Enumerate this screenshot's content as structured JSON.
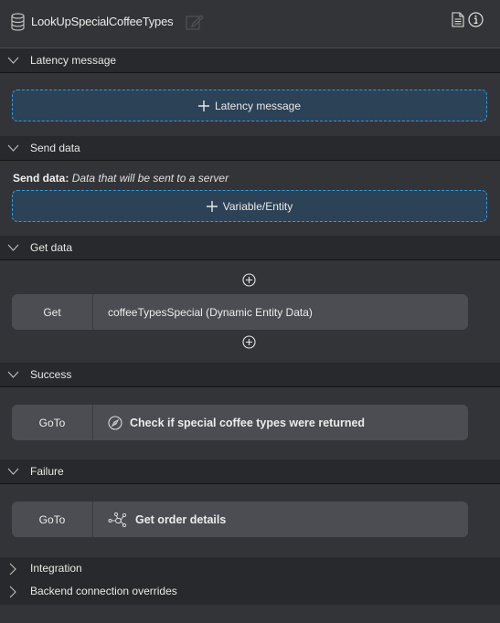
{
  "header": {
    "title": "LookUpSpecialCoffeeTypes",
    "icons": [
      "database-icon",
      "edit-icon",
      "document-icon",
      "info-icon"
    ]
  },
  "sections": {
    "latency": {
      "label": "Latency message",
      "expanded": true,
      "add_button_label": "Latency message"
    },
    "send_data": {
      "label": "Send data",
      "expanded": true,
      "caption_bold": "Send data:",
      "caption_italic": "Data that will be sent to a server",
      "add_button_label": "Variable/Entity"
    },
    "get_data": {
      "label": "Get data",
      "expanded": true,
      "row": {
        "op": "Get",
        "value": "coffeeTypesSpecial (Dynamic Entity Data)"
      }
    },
    "success": {
      "label": "Success",
      "expanded": true,
      "row": {
        "op": "GoTo",
        "icon": "compass-icon",
        "value": "Check if special coffee types were returned"
      }
    },
    "failure": {
      "label": "Failure",
      "expanded": true,
      "row": {
        "op": "GoTo",
        "icon": "flow-node-icon",
        "value": "Get order details"
      }
    },
    "integration": {
      "label": "Integration",
      "expanded": false
    },
    "backend": {
      "label": "Backend connection overrides",
      "expanded": false
    }
  },
  "colors": {
    "background": "#333438",
    "section_header": "#28292c",
    "dashed_button_bg": "#2c4256",
    "dashed_border": "#2a9de0",
    "row_bg": "#4b4d52"
  }
}
